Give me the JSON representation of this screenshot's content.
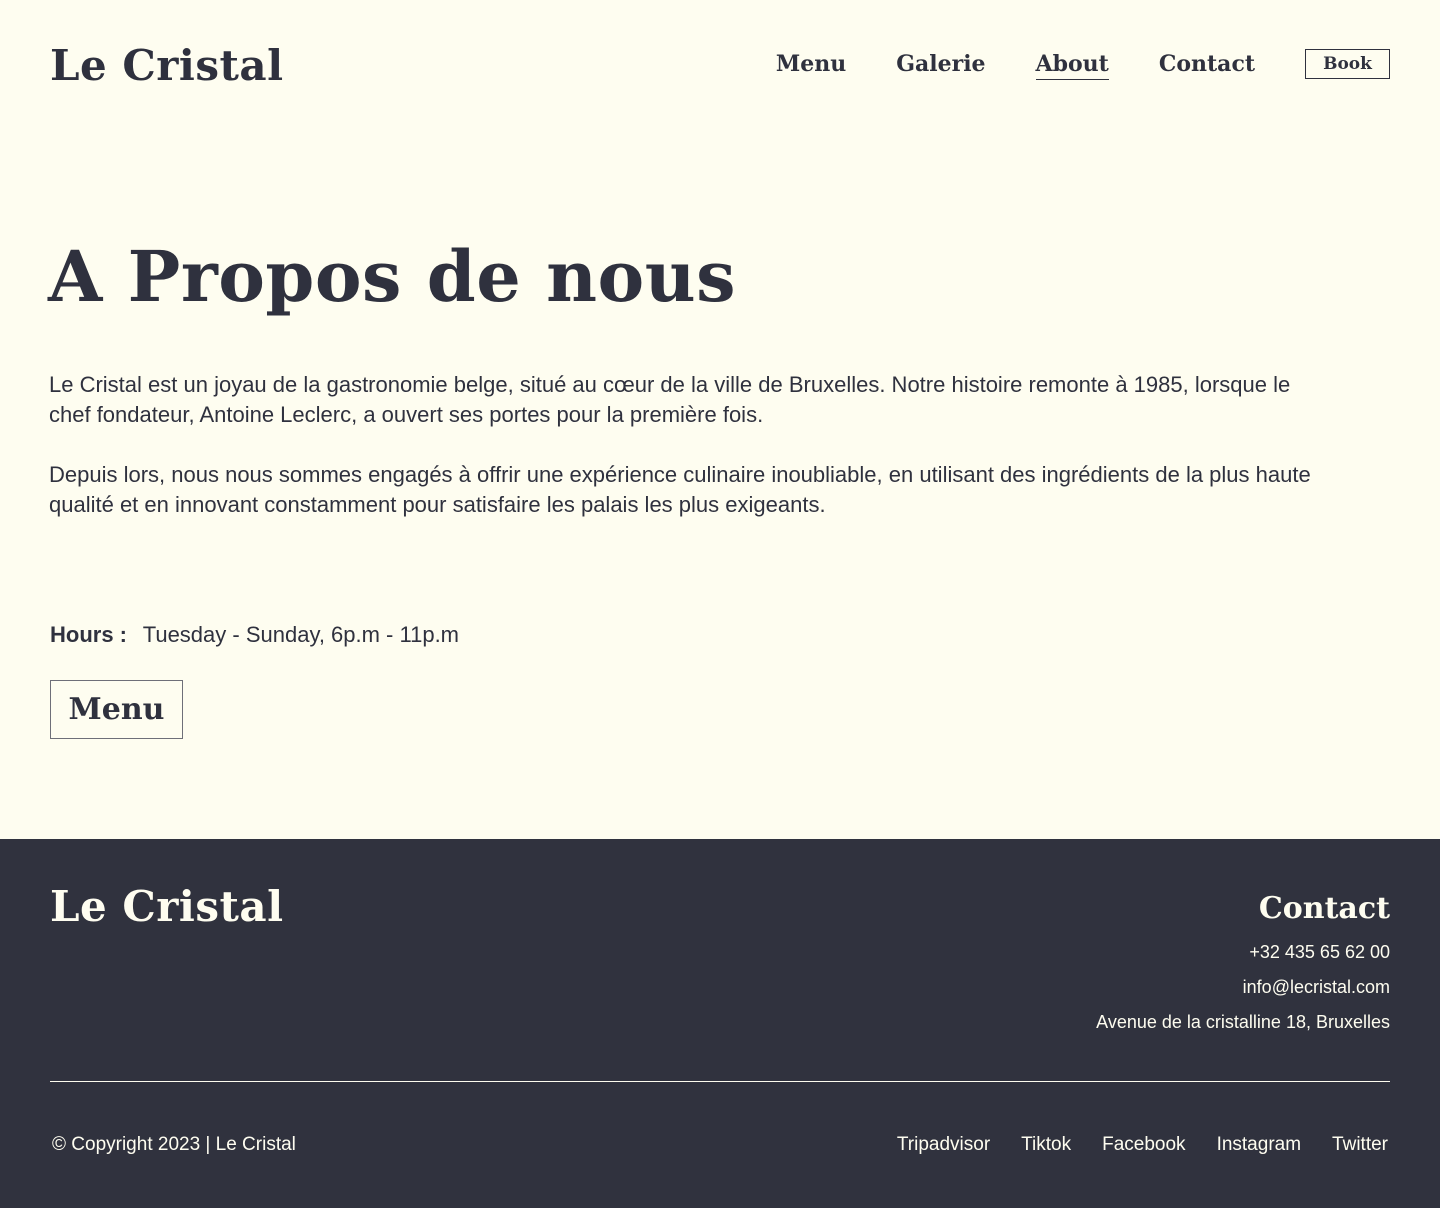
{
  "header": {
    "logo": "Le Cristal",
    "nav": {
      "menu": "Menu",
      "galerie": "Galerie",
      "about": "About",
      "contact": "Contact",
      "book": "Book"
    },
    "active_item": "About"
  },
  "main": {
    "title": "A Propos de nous",
    "paragraphs": [
      "Le Cristal est un joyau de la gastronomie belge, situé au cœur de la ville de Bruxelles. Notre histoire remonte à 1985, lorsque le chef fondateur, Antoine Leclerc, a ouvert ses portes pour la première fois.",
      "Depuis lors, nous nous sommes engagés à offrir une expérience culinaire inoubliable, en utilisant des ingrédients de la plus haute qualité et en innovant constamment pour satisfaire les palais les plus exigeants."
    ],
    "hours": {
      "label": "Hours :",
      "value": "Tuesday - Sunday, 6p.m - 11p.m"
    },
    "menu_button": "Menu"
  },
  "footer": {
    "logo": "Le Cristal",
    "contact": {
      "title": "Contact",
      "phone": "+32 435 65 62 00",
      "email": "info@lecristal.com",
      "address": "Avenue de la cristalline 18, Bruxelles"
    },
    "copyright": "© Copyright 2023 | Le Cristal",
    "social": [
      "Tripadvisor",
      "Tiktok",
      "Facebook",
      "Instagram",
      "Twitter"
    ]
  },
  "colors": {
    "background": "#fefdf0",
    "text": "#2f313e",
    "footer_background": "#30323e"
  }
}
